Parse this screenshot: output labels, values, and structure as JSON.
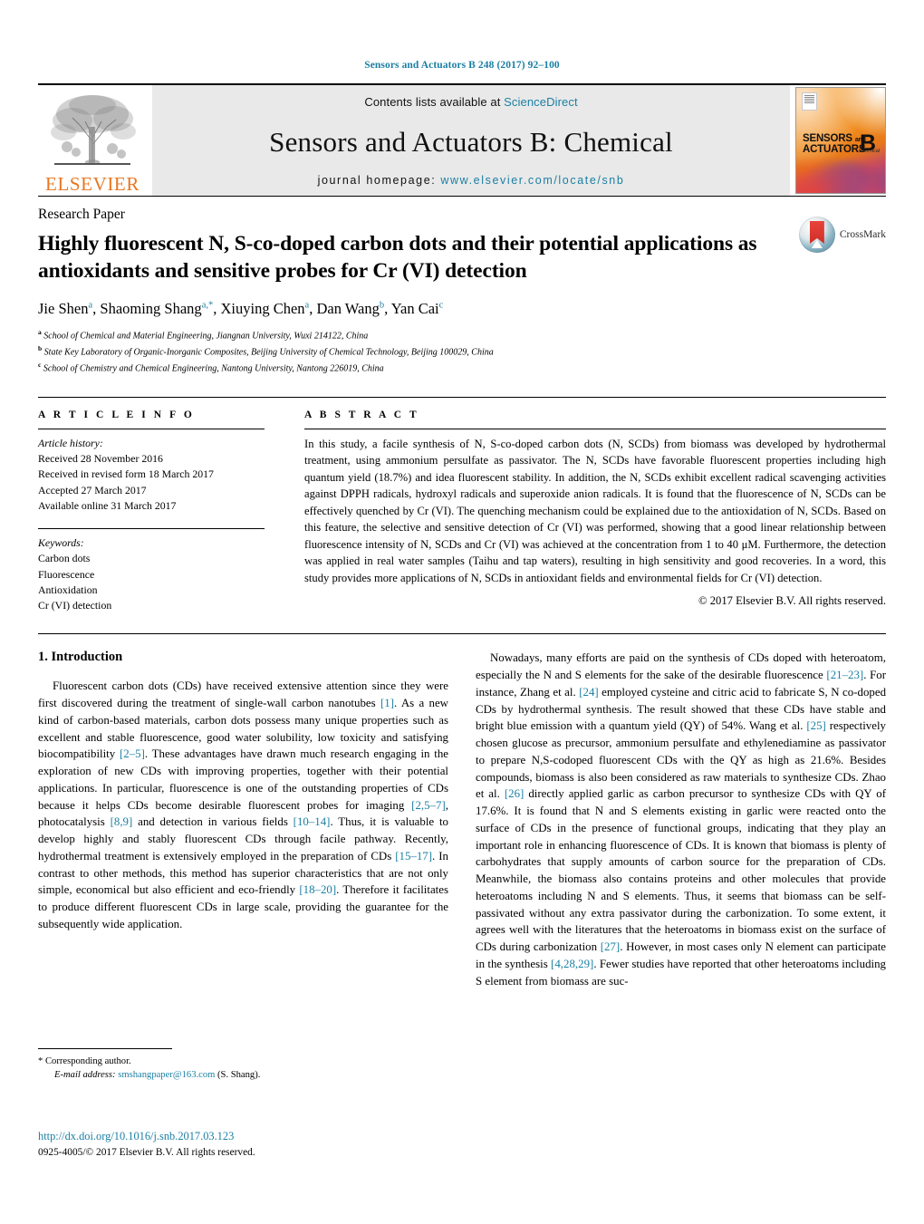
{
  "running_head": "Sensors and Actuators B 248 (2017) 92–100",
  "masthead": {
    "elsevier_wordmark": "ELSEVIER",
    "contents_prefix": "Contents lists available at ",
    "contents_link": "ScienceDirect",
    "journal_title": "Sensors and Actuators B: Chemical",
    "homepage_prefix": "journal homepage: ",
    "homepage_url": "www.elsevier.com/locate/snb",
    "cover": {
      "line1": "SENSORS",
      "and": "and",
      "line2": "ACTUATORS",
      "letter": "B",
      "sub": "Chemical"
    }
  },
  "article": {
    "kicker": "Research Paper",
    "title": "Highly fluorescent N, S-co-doped carbon dots and their potential applications as antioxidants and sensitive probes for Cr (VI) detection",
    "crossmark_label": "CrossMark",
    "authors": [
      {
        "name": "Jie Shen",
        "sup": "a",
        "sep": ", "
      },
      {
        "name": "Shaoming Shang",
        "sup": "a,*",
        "sep": ", "
      },
      {
        "name": "Xiuying Chen",
        "sup": "a",
        "sep": ", "
      },
      {
        "name": "Dan Wang",
        "sup": "b",
        "sep": ", "
      },
      {
        "name": "Yan Cai",
        "sup": "c",
        "sep": ""
      }
    ],
    "affiliations": [
      {
        "sup": "a",
        "text": "School of Chemical and Material Engineering, Jiangnan University, Wuxi 214122, China"
      },
      {
        "sup": "b",
        "text": "State Key Laboratory of Organic-Inorganic Composites, Beijing University of Chemical Technology, Beijing 100029, China"
      },
      {
        "sup": "c",
        "text": "School of Chemistry and Chemical Engineering, Nantong University, Nantong 226019, China"
      }
    ]
  },
  "article_info": {
    "heading": "A R T I C L E    I N F O",
    "history_label": "Article history:",
    "history": [
      "Received 28 November 2016",
      "Received in revised form 18 March 2017",
      "Accepted 27 March 2017",
      "Available online 31 March 2017"
    ],
    "keywords_label": "Keywords:",
    "keywords": [
      "Carbon dots",
      "Fluorescence",
      "Antioxidation",
      "Cr (VI) detection"
    ]
  },
  "abstract": {
    "heading": "A B S T R A C T",
    "text": "In this study, a facile synthesis of N, S-co-doped carbon dots (N, SCDs) from biomass was developed by hydrothermal treatment, using ammonium persulfate as passivator. The N, SCDs have favorable fluorescent properties including high quantum yield (18.7%) and idea fluorescent stability. In addition, the N, SCDs exhibit excellent radical scavenging activities against DPPH radicals, hydroxyl radicals and superoxide anion radicals. It is found that the fluorescence of N, SCDs can be effectively quenched by Cr (VI). The quenching mechanism could be explained due to the antioxidation of N, SCDs. Based on this feature, the selective and sensitive detection of Cr (VI) was performed, showing that a good linear relationship between fluorescence intensity of N, SCDs and Cr (VI) was achieved at the concentration from 1 to 40 μM. Furthermore, the detection was applied in real water samples (Taihu and tap waters), resulting in high sensitivity and good recoveries. In a word, this study provides more applications of N, SCDs in antioxidant fields and environmental fields for Cr (VI) detection.",
    "copyright": "© 2017 Elsevier B.V. All rights reserved."
  },
  "body": {
    "section_heading": "1.  Introduction",
    "left_paragraphs": [
      "Fluorescent carbon dots (CDs) have received extensive attention since they were first discovered during the treatment of single-wall carbon nanotubes [1]. As a new kind of carbon-based materials, carbon dots possess many unique properties such as excellent and stable fluorescence, good water solubility, low toxicity and satisfying biocompatibility [2–5]. These advantages have drawn much research engaging in the exploration of new CDs with improving properties, together with their potential applications. In particular, fluorescence is one of the outstanding properties of CDs because it helps CDs become desirable fluorescent probes for imaging [2,5–7], photocatalysis [8,9] and detection in various fields [10–14]. Thus, it is valuable to develop highly and stably fluorescent CDs through facile pathway. Recently, hydrothermal treatment is extensively employed in the preparation of CDs [15–17]. In contrast to other methods, this method has superior characteristics that are not only simple, economical but also efficient and eco-friendly [18–20]. Therefore it facilitates to produce different fluorescent CDs in large scale, providing the guarantee for the subsequently wide application."
    ],
    "right_paragraphs": [
      "Nowadays, many efforts are paid on the synthesis of CDs doped with heteroatom, especially the N and S elements for the sake of the desirable fluorescence [21–23]. For instance, Zhang et al. [24] employed cysteine and citric acid to fabricate S, N co-doped CDs by hydrothermal synthesis. The result showed that these CDs have stable and bright blue emission with a quantum yield (QY) of 54%. Wang et al. [25] respectively chosen glucose as precursor, ammonium persulfate and ethylenediamine as passivator to prepare N,S-codoped fluorescent CDs with the QY as high as 21.6%. Besides compounds, biomass is also been considered as raw materials to synthesize CDs. Zhao et al. [26] directly applied garlic as carbon precursor to synthesize CDs with QY of 17.6%. It is found that N and S elements existing in garlic were reacted onto the surface of CDs in the presence of functional groups, indicating that they play an important role in enhancing fluorescence of CDs. It is known that biomass is plenty of carbohydrates that supply amounts of carbon source for the preparation of CDs. Meanwhile, the biomass also contains proteins and other molecules that provide heteroatoms including N and S elements. Thus, it seems that biomass can be self-passivated without any extra passivator during the carbonization. To some extent, it agrees well with the literatures that the heteroatoms in biomass exist on the surface of CDs during carbonization [27]. However, in most cases only N element can participate in the synthesis [4,28,29]. Fewer studies have reported that other heteroatoms including S element from biomass are suc-"
    ]
  },
  "footnotes": {
    "corresponding_marker": "*",
    "corresponding_text": "Corresponding author.",
    "email_label": "E-mail address:",
    "email": "smshangpaper@163.com",
    "email_owner": "(S. Shang).",
    "doi": "http://dx.doi.org/10.1016/j.snb.2017.03.123",
    "issn_line": "0925-4005/© 2017 Elsevier B.V. All rights reserved."
  },
  "colors": {
    "link": "#1b7fa3",
    "elsevier_orange": "#E87722",
    "band_grey": "#e9e9e9"
  }
}
